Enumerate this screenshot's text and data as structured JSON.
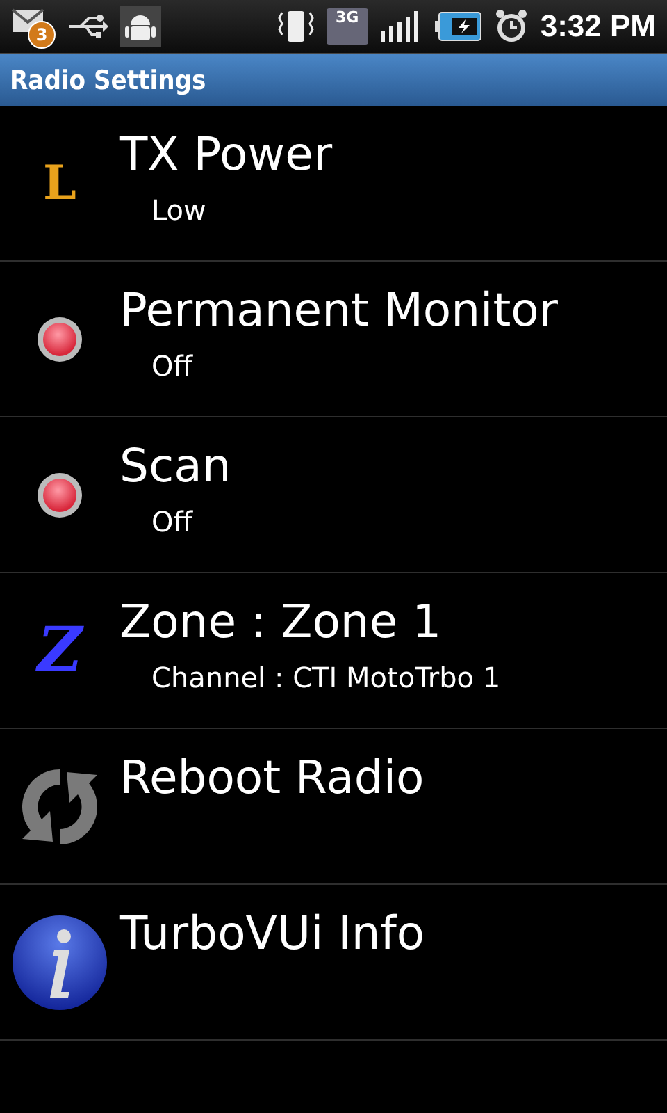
{
  "status_bar": {
    "notification_count": "3",
    "network_label": "3G",
    "time": "3:32 PM"
  },
  "title_bar": {
    "title": "Radio Settings"
  },
  "items": [
    {
      "kind": "letter",
      "glyph": "L",
      "color": "#e8a21c",
      "title": "TX Power",
      "summary": "Low"
    },
    {
      "kind": "led",
      "title": "Permanent Monitor",
      "summary": "Off"
    },
    {
      "kind": "led",
      "title": "Scan",
      "summary": "Off"
    },
    {
      "kind": "letter",
      "glyph": "Z",
      "color": "#3a3aff",
      "title": "Zone : Zone 1",
      "summary": "Channel : CTI MotoTrbo 1"
    },
    {
      "kind": "refresh",
      "title": "Reboot Radio"
    },
    {
      "kind": "info",
      "title": "TurboVUi Info"
    }
  ]
}
